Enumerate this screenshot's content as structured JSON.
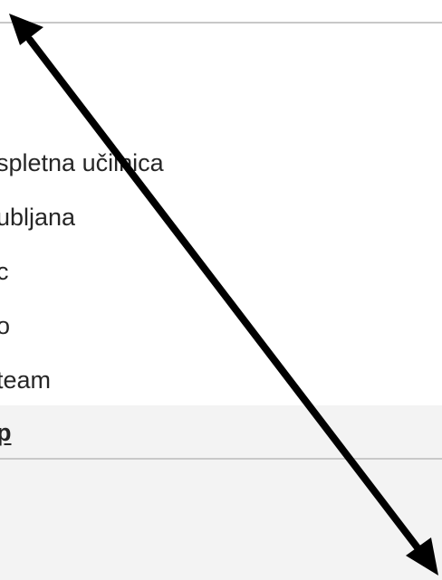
{
  "menu": {
    "items": [
      {
        "label": "spletna učilnica"
      },
      {
        "label": "ubljana"
      },
      {
        "label": "c"
      },
      {
        "label": "o"
      },
      {
        "label": "team"
      },
      {
        "label": "p"
      }
    ]
  },
  "colors": {
    "active_bg": "#f3f3f3",
    "divider": "#c8c8c8",
    "text": "#262626",
    "arrow": "#000000"
  }
}
